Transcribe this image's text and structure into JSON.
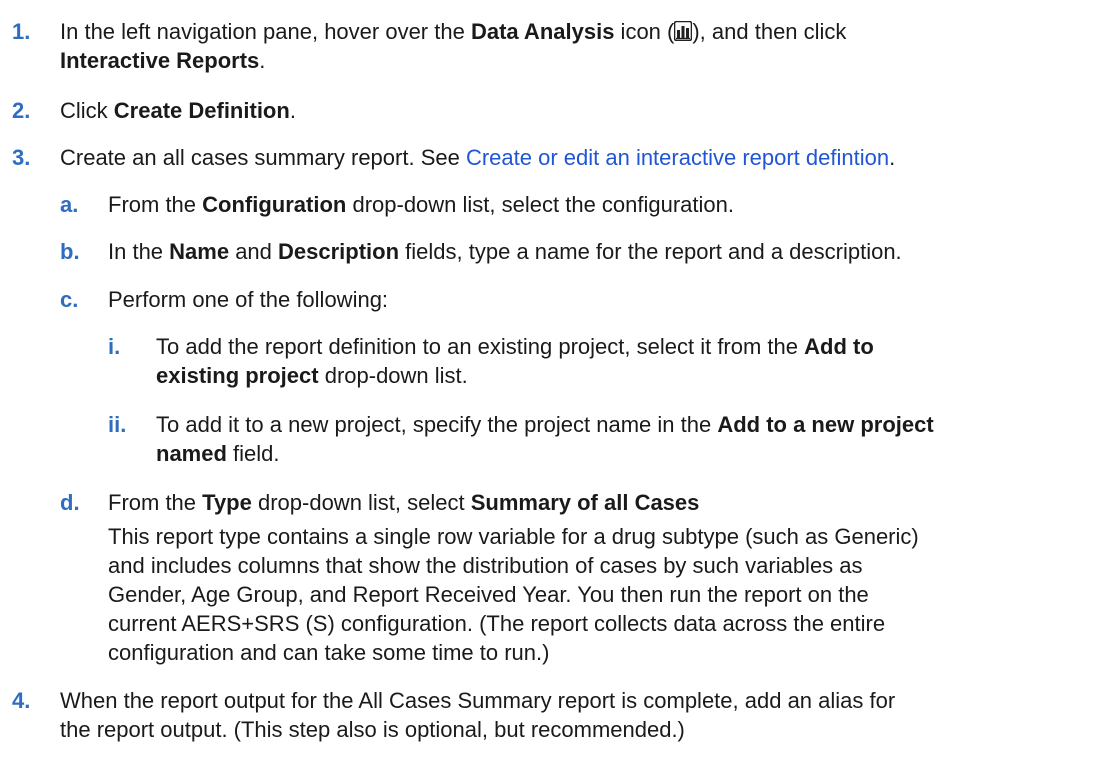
{
  "steps": {
    "s1": {
      "num": "1.",
      "a": "In the left navigation pane, hover over the ",
      "b": "Data Analysis",
      "c": " icon (",
      "icon": "data-analysis-icon",
      "d": "), and then click",
      "e": "Interactive Reports",
      "f": "."
    },
    "s2": {
      "num": "2.",
      "a": "Click ",
      "b": "Create Definition",
      "c": "."
    },
    "s3": {
      "num": "3.",
      "a": "Create an all cases summary report. See ",
      "link": "Create or edit an interactive report defintion",
      "b": ".",
      "sa": {
        "num": "a.",
        "a": "From the ",
        "b": "Configuration",
        "c": " drop-down list, select the configuration."
      },
      "sb": {
        "num": "b.",
        "a": "In the ",
        "b": "Name",
        "c": " and ",
        "d": "Description",
        "e": " fields, type a name for the report and a description."
      },
      "sc": {
        "num": "c.",
        "a": "Perform one of the following:",
        "i": {
          "num": "i.",
          "a": "To add the report definition to an existing project, select it from the ",
          "b": "Add to",
          "c": "existing project",
          "d": " drop-down list."
        },
        "ii": {
          "num": "ii.",
          "a": "To add it to a new project, specify the project name in the ",
          "b": "Add to a new project",
          "c": "named",
          "d": " field."
        }
      },
      "sd": {
        "num": "d.",
        "a": "From the ",
        "b": "Type",
        "c": " drop-down list, select ",
        "d": "Summary of all Cases",
        "p1": "This report type contains a single row variable for a drug subtype (such as Generic)",
        "p2": "and includes columns that show the distribution of cases by such variables as",
        "p3": "Gender, Age Group, and Report Received Year. You then run the report on the",
        "p4": "current AERS+SRS (S) configuration. (The report collects data across the entire",
        "p5": "configuration and can take some time to run.)"
      }
    },
    "s4": {
      "num": "4.",
      "l1": "When the report output for the All Cases Summary report is complete, add an alias for",
      "l2": "the report output. (This step also is optional, but recommended.)"
    }
  }
}
